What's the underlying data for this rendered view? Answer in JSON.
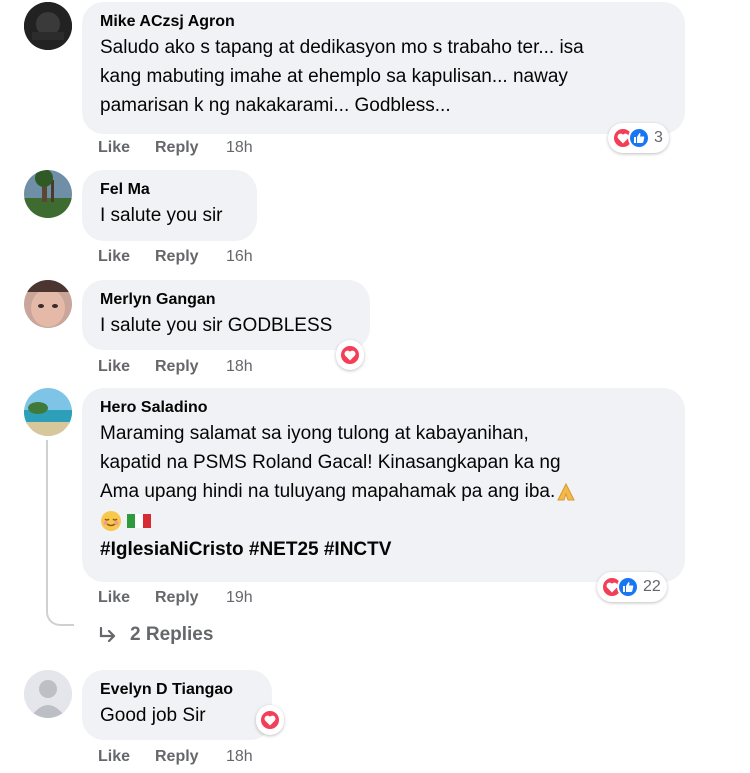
{
  "comments": [
    {
      "author": "Mike ACzsj Agron",
      "lines": [
        "Saludo ako s tapang at dedikasyon mo s trabaho ter... isa",
        "kang mabuting imahe at ehemplo sa kapulisan... naway",
        "pamarisan k ng nakakarami... Godbless..."
      ],
      "like": "Like",
      "reply": "Reply",
      "time": "18h",
      "reactions": [
        "heart",
        "like"
      ],
      "reaction_count": "3"
    },
    {
      "author": "Fel Ma",
      "lines": [
        "I salute you sir"
      ],
      "like": "Like",
      "reply": "Reply",
      "time": "16h"
    },
    {
      "author": "Merlyn Gangan",
      "lines": [
        "I salute you sir GODBLESS"
      ],
      "like": "Like",
      "reply": "Reply",
      "time": "18h",
      "reactions": [
        "heart"
      ]
    },
    {
      "author": "Hero Saladino",
      "lines": [
        "Maraming salamat sa iyong tulong at kabayanihan,",
        "kapatid na PSMS Roland Gacal! Kinasangkapan ka ng",
        "Ama upang hindi na tuluyang mapahamak pa ang iba."
      ],
      "hashtags": "#IglesiaNiCristo #NET25 #INCTV",
      "like": "Like",
      "reply": "Reply",
      "time": "19h",
      "reactions": [
        "heart",
        "like"
      ],
      "reaction_count": "22",
      "replies_label": "2 Replies"
    },
    {
      "author": "Evelyn D Tiangao",
      "lines": [
        "Good job Sir"
      ],
      "like": "Like",
      "reply": "Reply",
      "time": "18h",
      "reactions": [
        "heart"
      ]
    }
  ],
  "colors": {
    "bubble": "#f0f2f5",
    "meta_text": "#65676b",
    "heart": "#f33e58",
    "like": "#1877f2"
  }
}
